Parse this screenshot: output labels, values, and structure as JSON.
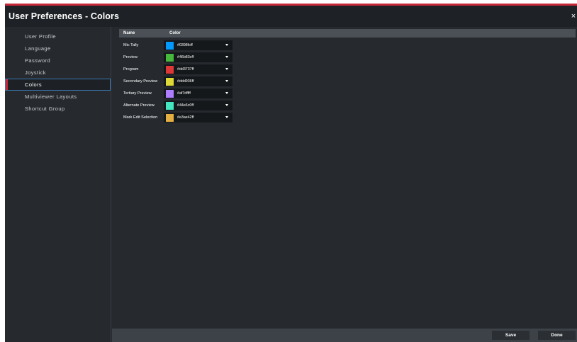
{
  "window": {
    "title": "User Preferences - Colors",
    "close_label": "×"
  },
  "sidebar": {
    "items": [
      {
        "label": "User Profile",
        "active": false
      },
      {
        "label": "Language",
        "active": false
      },
      {
        "label": "Password",
        "active": false
      },
      {
        "label": "Joystick",
        "active": false
      },
      {
        "label": "Colors",
        "active": true
      },
      {
        "label": "Multiviewer Layouts",
        "active": false
      },
      {
        "label": "Shortcut Group",
        "active": false
      }
    ]
  },
  "table": {
    "headers": {
      "name": "Name",
      "color": "Color"
    },
    "rows": [
      {
        "name": "Mic Tally",
        "value": "#0398fcff",
        "swatch": "#0398fc"
      },
      {
        "name": "Preview",
        "value": "#46b83cff",
        "swatch": "#46b83c"
      },
      {
        "name": "Program",
        "value": "#dd3737ff",
        "swatch": "#dd3737"
      },
      {
        "name": "Secondary Preview",
        "value": "#ddd936ff",
        "swatch": "#ddd936"
      },
      {
        "name": "Tertiary Preview",
        "value": "#af7dffff",
        "swatch": "#af7dff"
      },
      {
        "name": "Alternate Preview",
        "value": "#44e6c0ff",
        "swatch": "#44e6c0"
      },
      {
        "name": "Mark Edit Selection",
        "value": "#e3ae42ff",
        "swatch": "#e3ae42"
      }
    ]
  },
  "footer": {
    "save_label": "Save",
    "done_label": "Done"
  },
  "colors": {
    "accent": "#c6283a",
    "selection_border": "#3a78b0"
  }
}
